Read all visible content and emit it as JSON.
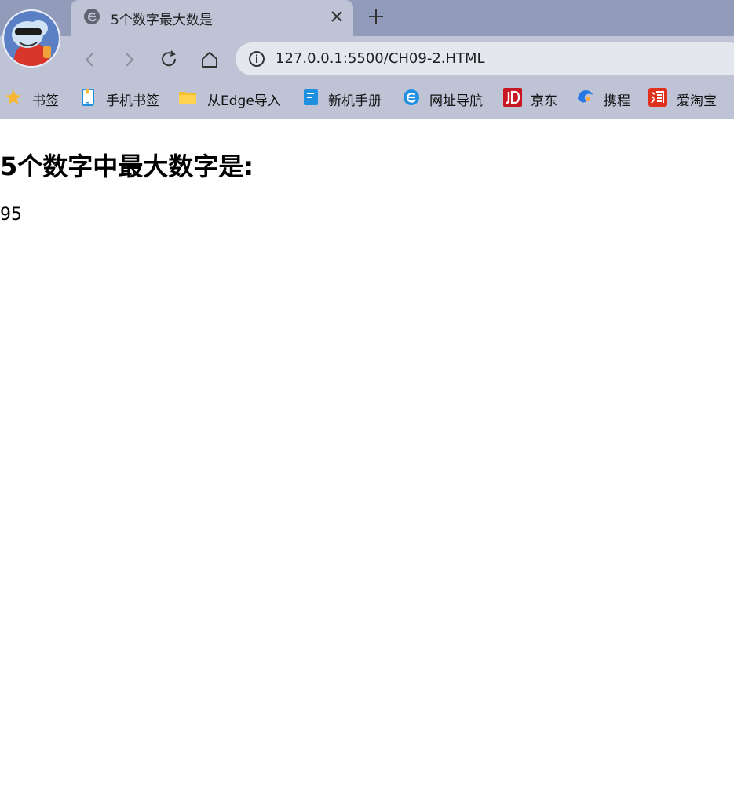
{
  "browser": {
    "tab": {
      "title": "5个数字最大数是"
    },
    "address_bar": {
      "url": "127.0.0.1:5500/CH09-2.HTML"
    },
    "bookmarks": [
      {
        "label": "书签",
        "icon": "star-icon"
      },
      {
        "label": "手机书签",
        "icon": "mobile-bookmark-icon"
      },
      {
        "label": "从Edge导入",
        "icon": "folder-icon"
      },
      {
        "label": "新机手册",
        "icon": "manual-icon"
      },
      {
        "label": "网址导航",
        "icon": "browser-e-icon"
      },
      {
        "label": "京东",
        "icon": "jd-logo-icon"
      },
      {
        "label": "携程",
        "icon": "ctrip-logo-icon"
      },
      {
        "label": "爱淘宝",
        "icon": "taobao-logo-icon"
      }
    ]
  },
  "page": {
    "heading": "5个数字中最大数字是:",
    "result": "95"
  },
  "colors": {
    "tabstrip": "#929cba",
    "toolbar": "#bec4d6",
    "address_bg": "#e4e7ee",
    "jd_red": "#c81623",
    "taobao_red": "#e0301e",
    "folder_yellow": "#f4c02e",
    "edge_blue": "#1f8fe0"
  }
}
